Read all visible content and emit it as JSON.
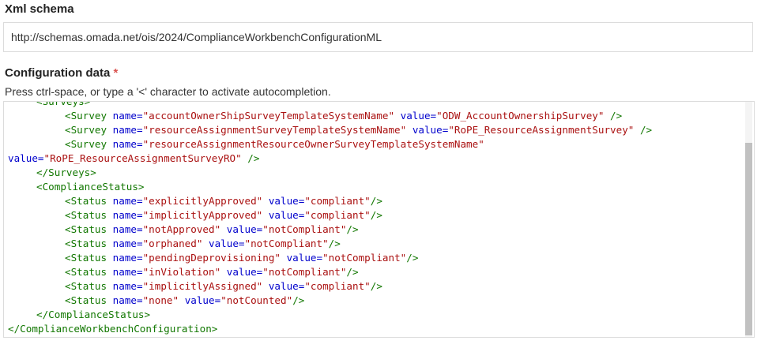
{
  "xml_schema": {
    "label": "Xml schema",
    "value": "http://schemas.omada.net/ois/2024/ComplianceWorkbenchConfigurationML"
  },
  "configuration_data": {
    "label": "Configuration data",
    "required_marker": "*",
    "hint": "Press ctrl-space, or type a '<' character to activate autocompletion."
  },
  "editor": {
    "lines": [
      {
        "indent": 1,
        "tokens": [
          {
            "t": "tag",
            "v": "<Surveys>"
          }
        ]
      },
      {
        "indent": 2,
        "tokens": [
          {
            "t": "tag",
            "v": "<Survey "
          },
          {
            "t": "attr",
            "v": "name="
          },
          {
            "t": "str",
            "v": "\"accountOwnerShipSurveyTemplateSystemName\""
          },
          {
            "t": "plain",
            "v": " "
          },
          {
            "t": "attr",
            "v": "value="
          },
          {
            "t": "str",
            "v": "\"ODW_AccountOwnershipSurvey\""
          },
          {
            "t": "tag",
            "v": " />"
          }
        ]
      },
      {
        "indent": 2,
        "tokens": [
          {
            "t": "tag",
            "v": "<Survey "
          },
          {
            "t": "attr",
            "v": "name="
          },
          {
            "t": "str",
            "v": "\"resourceAssignmentSurveyTemplateSystemName\""
          },
          {
            "t": "plain",
            "v": " "
          },
          {
            "t": "attr",
            "v": "value="
          },
          {
            "t": "str",
            "v": "\"RoPE_ResourceAssignmentSurvey\""
          },
          {
            "t": "tag",
            "v": " />"
          }
        ]
      },
      {
        "indent": 2,
        "tokens": [
          {
            "t": "tag",
            "v": "<Survey "
          },
          {
            "t": "attr",
            "v": "name="
          },
          {
            "t": "str",
            "v": "\"resourceAssignmentResourceOwnerSurveyTemplateSystemName\""
          }
        ]
      },
      {
        "indent": 0,
        "tokens": [
          {
            "t": "attr",
            "v": "value="
          },
          {
            "t": "str",
            "v": "\"RoPE_ResourceAssignmentSurveyRO\""
          },
          {
            "t": "tag",
            "v": " />"
          }
        ]
      },
      {
        "indent": 1,
        "tokens": [
          {
            "t": "tag",
            "v": "</Surveys>"
          }
        ]
      },
      {
        "indent": 1,
        "tokens": [
          {
            "t": "tag",
            "v": "<ComplianceStatus>"
          }
        ]
      },
      {
        "indent": 2,
        "tokens": [
          {
            "t": "tag",
            "v": "<Status "
          },
          {
            "t": "attr",
            "v": "name="
          },
          {
            "t": "str",
            "v": "\"explicitlyApproved\""
          },
          {
            "t": "plain",
            "v": " "
          },
          {
            "t": "attr",
            "v": "value="
          },
          {
            "t": "str",
            "v": "\"compliant\""
          },
          {
            "t": "tag",
            "v": "/>"
          }
        ]
      },
      {
        "indent": 2,
        "tokens": [
          {
            "t": "tag",
            "v": "<Status "
          },
          {
            "t": "attr",
            "v": "name="
          },
          {
            "t": "str",
            "v": "\"implicitlyApproved\""
          },
          {
            "t": "plain",
            "v": " "
          },
          {
            "t": "attr",
            "v": "value="
          },
          {
            "t": "str",
            "v": "\"compliant\""
          },
          {
            "t": "tag",
            "v": "/>"
          }
        ]
      },
      {
        "indent": 2,
        "tokens": [
          {
            "t": "tag",
            "v": "<Status "
          },
          {
            "t": "attr",
            "v": "name="
          },
          {
            "t": "str",
            "v": "\"notApproved\""
          },
          {
            "t": "plain",
            "v": " "
          },
          {
            "t": "attr",
            "v": "value="
          },
          {
            "t": "str",
            "v": "\"notCompliant\""
          },
          {
            "t": "tag",
            "v": "/>"
          }
        ]
      },
      {
        "indent": 2,
        "tokens": [
          {
            "t": "tag",
            "v": "<Status "
          },
          {
            "t": "attr",
            "v": "name="
          },
          {
            "t": "str",
            "v": "\"orphaned\""
          },
          {
            "t": "plain",
            "v": " "
          },
          {
            "t": "attr",
            "v": "value="
          },
          {
            "t": "str",
            "v": "\"notCompliant\""
          },
          {
            "t": "tag",
            "v": "/>"
          }
        ]
      },
      {
        "indent": 2,
        "tokens": [
          {
            "t": "tag",
            "v": "<Status "
          },
          {
            "t": "attr",
            "v": "name="
          },
          {
            "t": "str",
            "v": "\"pendingDeprovisioning\""
          },
          {
            "t": "plain",
            "v": " "
          },
          {
            "t": "attr",
            "v": "value="
          },
          {
            "t": "str",
            "v": "\"notCompliant\""
          },
          {
            "t": "tag",
            "v": "/>"
          }
        ]
      },
      {
        "indent": 2,
        "tokens": [
          {
            "t": "tag",
            "v": "<Status "
          },
          {
            "t": "attr",
            "v": "name="
          },
          {
            "t": "str",
            "v": "\"inViolation\""
          },
          {
            "t": "plain",
            "v": " "
          },
          {
            "t": "attr",
            "v": "value="
          },
          {
            "t": "str",
            "v": "\"notCompliant\""
          },
          {
            "t": "tag",
            "v": "/>"
          }
        ]
      },
      {
        "indent": 2,
        "tokens": [
          {
            "t": "tag",
            "v": "<Status "
          },
          {
            "t": "attr",
            "v": "name="
          },
          {
            "t": "str",
            "v": "\"implicitlyAssigned\""
          },
          {
            "t": "plain",
            "v": " "
          },
          {
            "t": "attr",
            "v": "value="
          },
          {
            "t": "str",
            "v": "\"compliant\""
          },
          {
            "t": "tag",
            "v": "/>"
          }
        ]
      },
      {
        "indent": 2,
        "tokens": [
          {
            "t": "tag",
            "v": "<Status "
          },
          {
            "t": "attr",
            "v": "name="
          },
          {
            "t": "str",
            "v": "\"none\""
          },
          {
            "t": "plain",
            "v": " "
          },
          {
            "t": "attr",
            "v": "value="
          },
          {
            "t": "str",
            "v": "\"notCounted\""
          },
          {
            "t": "tag",
            "v": "/>"
          }
        ]
      },
      {
        "indent": 1,
        "tokens": [
          {
            "t": "tag",
            "v": "</ComplianceStatus>"
          }
        ]
      },
      {
        "indent": 0,
        "tokens": [
          {
            "t": "tag",
            "v": "</ComplianceWorkbenchConfiguration>"
          }
        ]
      }
    ]
  },
  "colors": {
    "tag": "#117700",
    "attribute": "#0000cc",
    "string": "#aa1111",
    "required": "#d9534f"
  }
}
